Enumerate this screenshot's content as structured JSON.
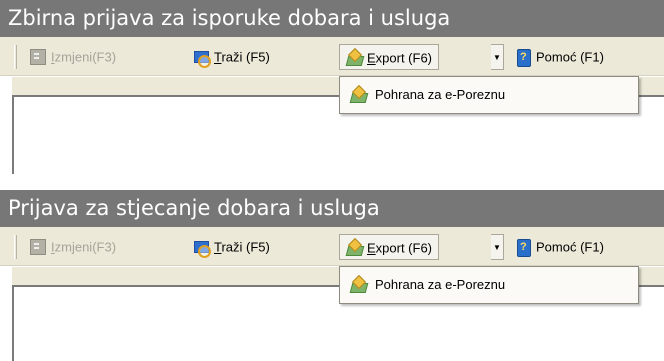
{
  "panels": [
    {
      "title": "Zbirna prijava za isporuke dobara i usluga",
      "toolbar": {
        "edit": {
          "label_first": "I",
          "label_rest": "zmjeni(F3)",
          "icon": "edit-icon",
          "enabled": false
        },
        "find": {
          "label_first": "T",
          "label_rest": "raži (F5)",
          "icon": "find-icon"
        },
        "export": {
          "label_first": "E",
          "label_rest": "xport (F6)",
          "icon": "export-icon",
          "dropdown_arrow": "▼"
        },
        "help": {
          "label": "Pomoć (F1)",
          "icon": "help-icon"
        }
      },
      "menu": {
        "items": [
          {
            "label": "Pohrana za e-Poreznu",
            "icon": "export-icon"
          }
        ]
      }
    },
    {
      "title": "Prijava za stjecanje dobara i usluga",
      "toolbar": {
        "edit": {
          "label_first": "I",
          "label_rest": "zmjeni(F3)",
          "icon": "edit-icon",
          "enabled": false
        },
        "find": {
          "label_first": "T",
          "label_rest": "raži (F5)",
          "icon": "find-icon"
        },
        "export": {
          "label_first": "E",
          "label_rest": "xport (F6)",
          "icon": "export-icon",
          "dropdown_arrow": "▼"
        },
        "help": {
          "label": "Pomoć (F1)",
          "icon": "help-icon"
        }
      },
      "menu": {
        "items": [
          {
            "label": "Pohrana za e-Poreznu",
            "icon": "export-icon"
          }
        ]
      }
    }
  ],
  "colors": {
    "titlebar_bg": "#777777",
    "titlebar_text": "#ffffff",
    "toolbar_bg": "#ece9d8",
    "disabled_text": "#a7a39a"
  }
}
